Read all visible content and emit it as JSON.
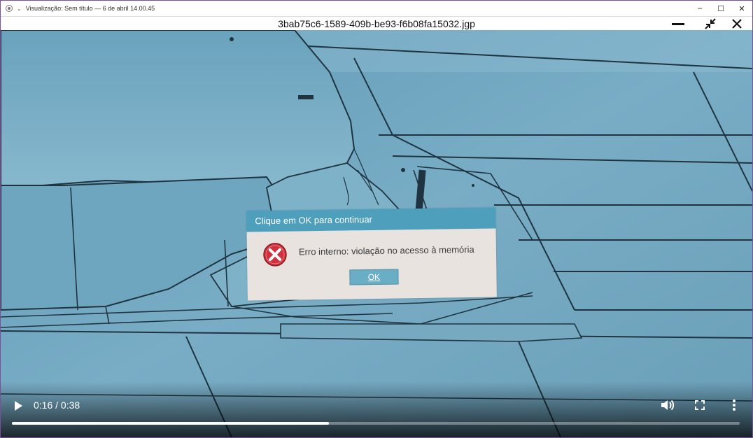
{
  "os_window": {
    "title": "Visualização: Sem título — 6 de abril 14.00.45",
    "controls": {
      "minimize": "–",
      "maximize": "☐",
      "close": "✕"
    }
  },
  "viewer": {
    "filename": "3bab75c6-1589-409b-be93-f6b08fa15032.jgp",
    "icons": [
      "minimize-icon",
      "exit-fullscreen-icon",
      "close-icon"
    ]
  },
  "dialog": {
    "title": "Clique em OK para continuar",
    "message": "Erro interno: violação no acesso à memória",
    "ok_label": "OK",
    "icon": "error-icon"
  },
  "player": {
    "time_label": "0:16 / 0:38",
    "progress_fraction": 0.436,
    "icons": [
      "play-icon",
      "volume-icon",
      "fullscreen-icon",
      "more-options-icon"
    ]
  }
}
